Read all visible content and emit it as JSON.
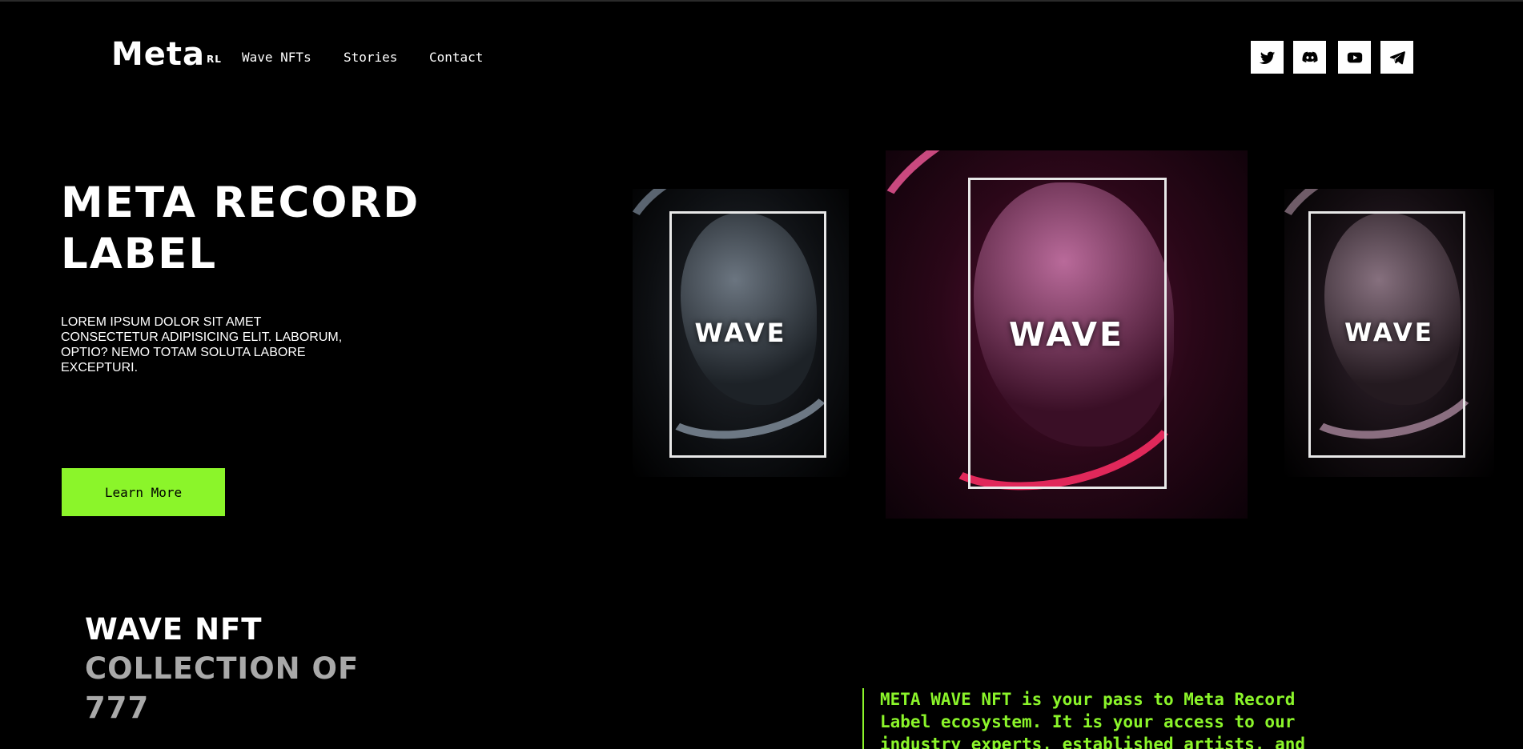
{
  "nav": {
    "logo": "Meta",
    "logo_sup": "RL",
    "links": [
      "Wave NFTs",
      "Stories",
      "Contact"
    ],
    "social": [
      "twitter-icon",
      "discord-icon",
      "youtube-icon",
      "telegram-icon"
    ]
  },
  "hero": {
    "title": "META RECORD LABEL",
    "description": "LOREM IPSUM DOLOR SIT AMET CONSECTETUR ADIPISICING ELIT. LABORUM, OPTIO? NEMO TOTAM SOLUTA LABORE EXCEPTURI.",
    "cta_label": "Learn More",
    "posters": [
      {
        "text": "WAVE",
        "theme": "grey"
      },
      {
        "text": "WAVE",
        "theme": "crimson"
      },
      {
        "text": "WAVE",
        "theme": "mauve"
      }
    ]
  },
  "collection": {
    "line1": "WAVE NFT",
    "line2": "COLLECTION OF",
    "line3": "777",
    "quote": "META WAVE NFT is your pass to Meta Record Label ecosystem. It is your access to our industry experts, established artists, and"
  },
  "colors": {
    "background": "#000000",
    "accent": "#8bf52a",
    "muted": "#a9a9a9"
  }
}
